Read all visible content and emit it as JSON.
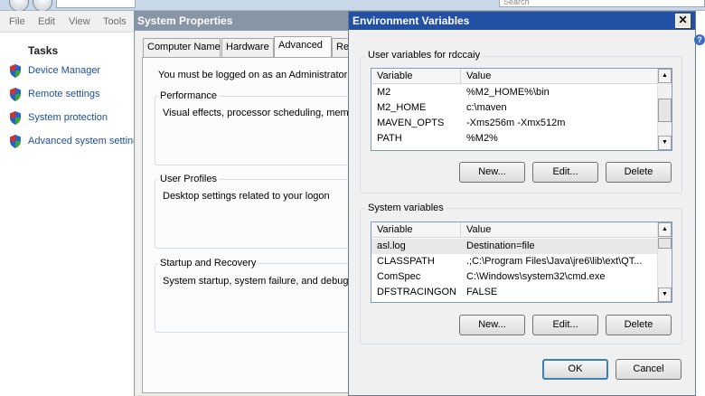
{
  "control_panel": {
    "search_placeholder": "Search",
    "menu": [
      "File",
      "Edit",
      "View",
      "Tools"
    ],
    "tasks_title": "Tasks",
    "tasks": [
      "Device Manager",
      "Remote settings",
      "System protection",
      "Advanced system settings"
    ]
  },
  "system_properties": {
    "title": "System Properties",
    "tabs": [
      "Computer Name",
      "Hardware",
      "Advanced",
      "Re"
    ],
    "active_tab": "Advanced",
    "admin_message": "You must be logged on as an Administrator to",
    "groups": [
      {
        "title": "Performance",
        "desc": "Visual effects, processor scheduling, memor"
      },
      {
        "title": "User Profiles",
        "desc": "Desktop settings related to your logon"
      },
      {
        "title": "Startup and Recovery",
        "desc": "System startup, system failure, and debuggi"
      }
    ]
  },
  "env_vars": {
    "title": "Environment Variables",
    "close_glyph": "✕",
    "user_group_title": "User variables for rdccaiy",
    "system_group_title": "System variables",
    "col_variable": "Variable",
    "col_value": "Value",
    "user_rows": [
      {
        "variable": "M2",
        "value": "%M2_HOME%\\bin"
      },
      {
        "variable": "M2_HOME",
        "value": "c:\\maven"
      },
      {
        "variable": "MAVEN_OPTS",
        "value": "-Xms256m -Xmx512m"
      },
      {
        "variable": "PATH",
        "value": "%M2%"
      }
    ],
    "system_rows": [
      {
        "variable": "asl.log",
        "value": "Destination=file"
      },
      {
        "variable": "CLASSPATH",
        "value": ".;C:\\Program Files\\Java\\jre6\\lib\\ext\\QT..."
      },
      {
        "variable": "ComSpec",
        "value": "C:\\Windows\\system32\\cmd.exe"
      },
      {
        "variable": "DFSTRACINGON",
        "value": "FALSE"
      }
    ],
    "buttons": {
      "new": "New...",
      "edit": "Edit...",
      "delete": "Delete",
      "ok": "OK",
      "cancel": "Cancel"
    }
  },
  "colors": {
    "title_active": "#2250a4",
    "title_inactive": "#8795a6",
    "link": "#1c4fa0"
  }
}
